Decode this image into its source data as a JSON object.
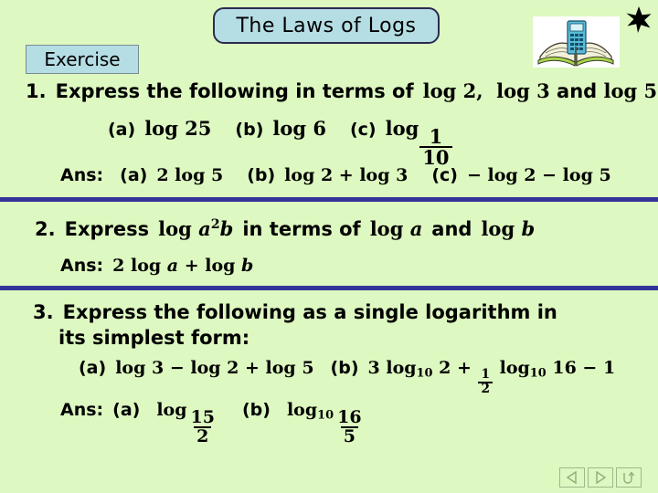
{
  "slide": {
    "title": "The Laws of Logs",
    "section_label": "Exercise",
    "background_color": "#ddf8c0",
    "box_color": "#b5dde4",
    "divider_color": "#333399"
  },
  "decor": {
    "clipart_name": "open-book-with-calculator",
    "star_name": "black-star"
  },
  "questions": [
    {
      "number": "1.",
      "prompt_text": "Express the following in terms of",
      "prompt_math": "log 2,  log 3  and  log 5",
      "parts": [
        {
          "label": "(a)",
          "expr": "log 25"
        },
        {
          "label": "(b)",
          "expr": "log 6"
        },
        {
          "label": "(c)",
          "expr": "log 1/10"
        }
      ],
      "answer_label": "Ans:",
      "answers": [
        {
          "label": "(a)",
          "expr": "2 log 5"
        },
        {
          "label": "(b)",
          "expr": "log 2 + log 3"
        },
        {
          "label": "(c)",
          "expr": "− log 2 − log 5"
        }
      ]
    },
    {
      "number": "2.",
      "prompt_text": "Express",
      "prompt_expr": "log a²b",
      "prompt_text2": "in terms of",
      "prompt_expr2": "log a",
      "prompt_and": "and",
      "prompt_expr3": "log b",
      "answer_label": "Ans:",
      "answer_expr": "2 log a + log b"
    },
    {
      "number": "3.",
      "prompt_line1": "Express the following as a single logarithm in",
      "prompt_line2": "its simplest form:",
      "parts": [
        {
          "label": "(a)",
          "expr": "log 3 − log 2 + log 5"
        },
        {
          "label": "(b)",
          "expr": "3 log₁₀ 2 + ½ log₁₀ 16 − 1"
        }
      ],
      "answer_label": "Ans:",
      "answers": [
        {
          "label": "(a)",
          "expr": "log 15/2"
        },
        {
          "label": "(b)",
          "expr": "log₁₀ 16/5"
        }
      ]
    }
  ],
  "nav": {
    "back_label": "◁",
    "forward_label": "▷",
    "return_label": "↺"
  }
}
